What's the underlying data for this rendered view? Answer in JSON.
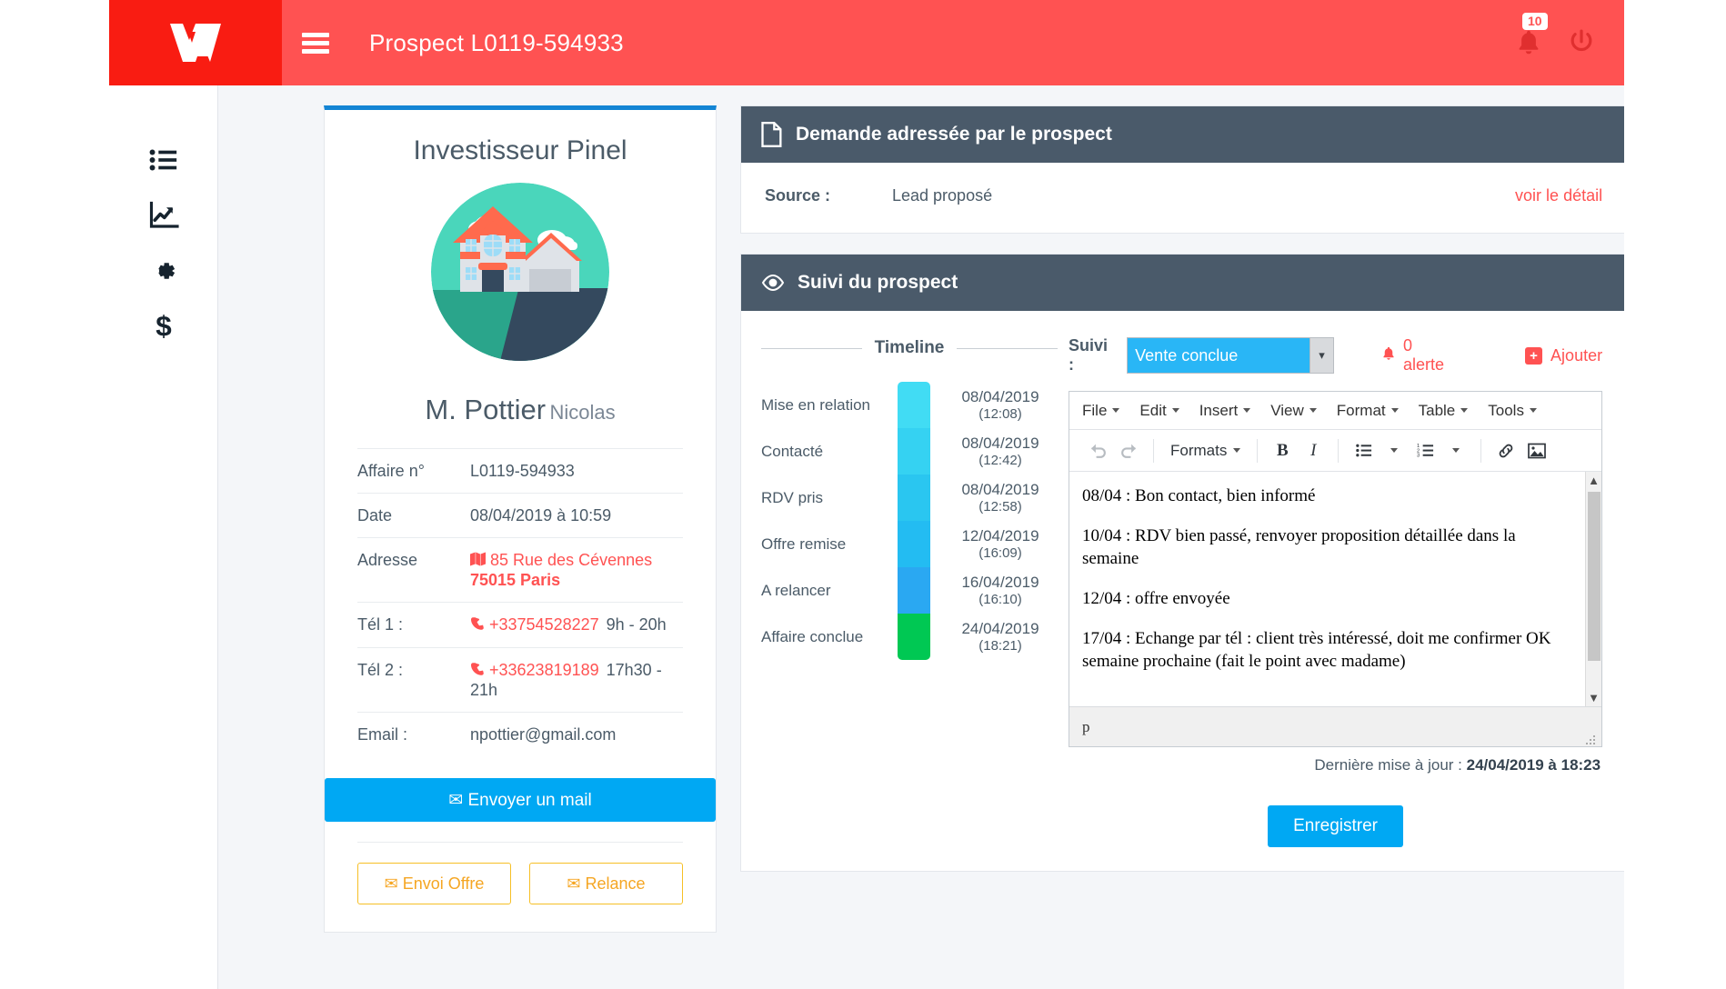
{
  "header": {
    "logo_alt": "vousfinancer-logo",
    "title": "Prospect L0119-594933",
    "notification_count": "10"
  },
  "sidebar": {
    "items": [
      {
        "name": "list-icon",
        "label": "Liste"
      },
      {
        "name": "chart-line-icon",
        "label": "Statistiques"
      },
      {
        "name": "gear-icon",
        "label": "Paramètres"
      },
      {
        "name": "dollar-icon",
        "label": "Finances"
      }
    ]
  },
  "profile": {
    "title": "Investisseur Pinel",
    "last_name": "M. Pottier",
    "first_name": "Nicolas",
    "rows": [
      {
        "label": "Affaire n°",
        "value": "L0119-594933"
      },
      {
        "label": "Date",
        "value": "08/04/2019 à 10:59"
      }
    ],
    "address": {
      "label": "Adresse",
      "line1": "85 Rue des Cévennes",
      "line2": "75015 Paris"
    },
    "tel1": {
      "label": "Tél 1 :",
      "number": "+33754528227",
      "hours": "9h - 20h"
    },
    "tel2": {
      "label": "Tél 2 :",
      "number": "+33623819189",
      "hours": "17h30 - 21h"
    },
    "email": {
      "label": "Email :",
      "value": "npottier@gmail.com"
    },
    "mail_button": "Envoyer un mail",
    "offer_button": "Envoi Offre",
    "relaunch_button": "Relance"
  },
  "demande_panel": {
    "title": "Demande adressée par le prospect",
    "source_label": "Source :",
    "source_value": "Lead proposé",
    "detail_link": "voir le détail"
  },
  "suivi_panel": {
    "title": "Suivi du prospect",
    "timeline_label": "Timeline",
    "timeline": [
      {
        "stage": "Mise en relation",
        "date": "08/04/2019",
        "time": "(12:08)",
        "color": "#41dcf4"
      },
      {
        "stage": "Contacté",
        "date": "08/04/2019",
        "time": "(12:42)",
        "color": "#35d2f2"
      },
      {
        "stage": "RDV pris",
        "date": "08/04/2019",
        "time": "(12:58)",
        "color": "#2ac6f0"
      },
      {
        "stage": "Offre remise",
        "date": "12/04/2019",
        "time": "(16:09)",
        "color": "#23bcf2"
      },
      {
        "stage": "A relancer",
        "date": "16/04/2019",
        "time": "(16:10)",
        "color": "#2aa8f2"
      },
      {
        "stage": "Affaire conclue",
        "date": "24/04/2019",
        "time": "(18:21)",
        "color": "#00c853"
      }
    ],
    "suivi_label": "Suivi :",
    "suivi_selected": "Vente conclue",
    "suivi_options": [
      "Vente conclue"
    ],
    "alert_text": "0 alerte",
    "add_text": "Ajouter",
    "last_update_label": "Dernière mise à jour :",
    "last_update_value": "24/04/2019 à 18:23",
    "save_button": "Enregistrer"
  },
  "editor": {
    "menus": [
      "File",
      "Edit",
      "Insert",
      "View",
      "Format",
      "Table",
      "Tools"
    ],
    "formats_label": "Formats",
    "toolbar_icons": [
      "undo-icon",
      "redo-icon",
      "formats-dropdown",
      "bold-icon",
      "italic-icon",
      "bullet-list-icon",
      "numbered-list-icon",
      "link-icon",
      "image-icon"
    ],
    "paragraphs": [
      "08/04 : Bon contact, bien informé",
      "10/04 : RDV bien passé, renvoyer proposition détaillée dans la semaine",
      "12/04 : offre envoyée",
      "17/04 : Echange par tél : client très intéressé, doit me confirmer OK semaine prochaine (fait le point avec madame)"
    ],
    "statusbar_path": "p"
  },
  "colors": {
    "brand_red": "#ff5252",
    "logo_red": "#f91c12",
    "panel_header": "#4a5a6a",
    "accent_blue": "#00a8f3",
    "card_top_blue": "#1384d4",
    "amber": "#f5a623",
    "page_bg": "#f4f6f9"
  }
}
